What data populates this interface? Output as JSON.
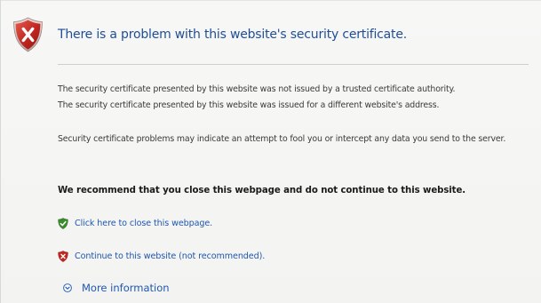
{
  "header": {
    "title": "There is a problem with this website's security certificate.",
    "icon": "shield-error-icon"
  },
  "details": {
    "lines": [
      "The security certificate presented by this website was not issued by a trusted certificate authority.",
      "The security certificate presented by this website was issued for a different website's address."
    ],
    "warning": "Security certificate problems may indicate an attempt to fool you or intercept any data you send to the server."
  },
  "recommendation": "We recommend that you close this webpage and do not continue to this website.",
  "actions": {
    "close": {
      "label": "Click here to close this webpage.",
      "icon": "shield-ok-icon"
    },
    "continue": {
      "label": "Continue to this website (not recommended).",
      "icon": "shield-error-icon"
    },
    "more": {
      "label": "More information",
      "icon": "expand-circle-icon"
    }
  },
  "colors": {
    "title": "#1f4e96",
    "link": "#1f57b0",
    "shield_red": "#c0261f",
    "shield_green": "#3c8a2e"
  }
}
